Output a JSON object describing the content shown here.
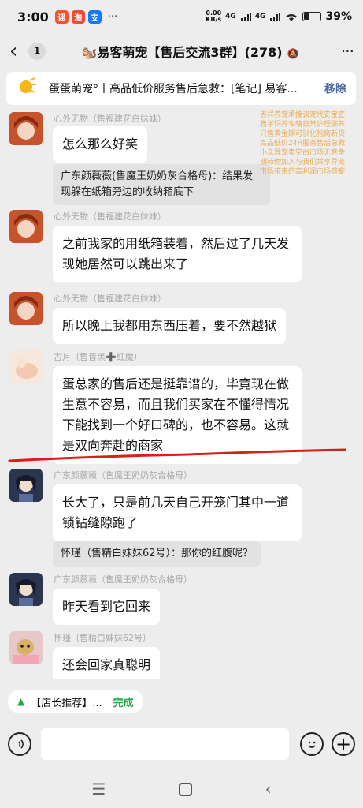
{
  "status": {
    "time": "3:00",
    "apps": [
      {
        "icon": "app-a-icon",
        "color": "#f5522d",
        "glyph": "谣"
      },
      {
        "icon": "app-b-icon",
        "color": "#ec4d3a",
        "glyph": "淘"
      },
      {
        "icon": "app-c-icon",
        "color": "#1677ff",
        "glyph": "支"
      }
    ],
    "more_dots": "···",
    "net_speed": "0.00",
    "net_unit": "KB/s",
    "signal1": "4G",
    "signal2": "4G",
    "battery_pct": "39%",
    "battery_level": 0.39
  },
  "header": {
    "back_icon": "chevron-left-icon",
    "unread": "1",
    "title": "🐿️易客萌宠【售后交流3群】(278)",
    "mute_icon": "bell-off-icon",
    "more": "···"
  },
  "pin": {
    "icon": "megaphone-icon",
    "text": "蛋蛋萌宠°丨高品低价服务售后急救：[笔记] 易客...",
    "remove": "移除"
  },
  "overlay_lines": [
    "吉祥养宠承接谈宠代安宝宣",
    "教学饲养攻略日常护理驯养",
    "只售黄金期可驯化狗窝新货",
    "高品低价24H服务售后急救",
    "小众异宠卖空白市场无竞争",
    "期待你加入与我们共享异宠",
    "市场带来的高利润市场盛宴"
  ],
  "messages": [
    {
      "id": "m1",
      "nick": "心外无物（售福建花白妹妹）",
      "text": "怎么那么好笑",
      "quote": "广东颜薇薇(售魔王奶奶灰合格母)：结果发现躲在纸箱旁边的收纳箱底下"
    },
    {
      "id": "m2",
      "nick": "心外无物（售福建花白妹妹）",
      "text": "之前我家的用纸箱装着，然后过了几天发现她居然可以跳出来了"
    },
    {
      "id": "m3",
      "nick": "心外无物（售福建花白妹妹）",
      "text": "所以晚上我都用东西压着，要不然越狱"
    },
    {
      "id": "m4",
      "nick": "古月（售皆黑➕红魔）",
      "text": "蛋总家的售后还是挺靠谱的，毕竟现在做生意不容易，而且我们买家在不懂得情况下能找到一个好口碑的，也不容易。这就是双向奔赴的商家"
    },
    {
      "id": "m5",
      "nick": "广东颜薇薇（售魔王奶奶灰合格母）",
      "text": "长大了，只是前几天自己开笼门其中一道锁钻缝隙跑了",
      "quote": "怀瑾（售精白妹妹62号）：那你的红腹呢？"
    },
    {
      "id": "m6",
      "nick": "广东颜薇薇（售魔王奶奶灰合格母）",
      "text": "昨天看到它回来"
    },
    {
      "id": "m7",
      "nick": "怀瑾（售精白妹妹62号）",
      "text": "还会回家真聪明"
    }
  ],
  "recommend": {
    "icon": "store-icon",
    "text": "【店长推荐】...",
    "status": "完成"
  },
  "input_bar": {
    "voice_icon": "voice-icon",
    "emoji_icon": "emoji-icon",
    "plus_icon": "plus-icon",
    "plus_glyph": "+"
  },
  "nav": {
    "menu_icon": "menu-icon",
    "home_icon": "home-icon",
    "back_icon": "back-icon"
  }
}
